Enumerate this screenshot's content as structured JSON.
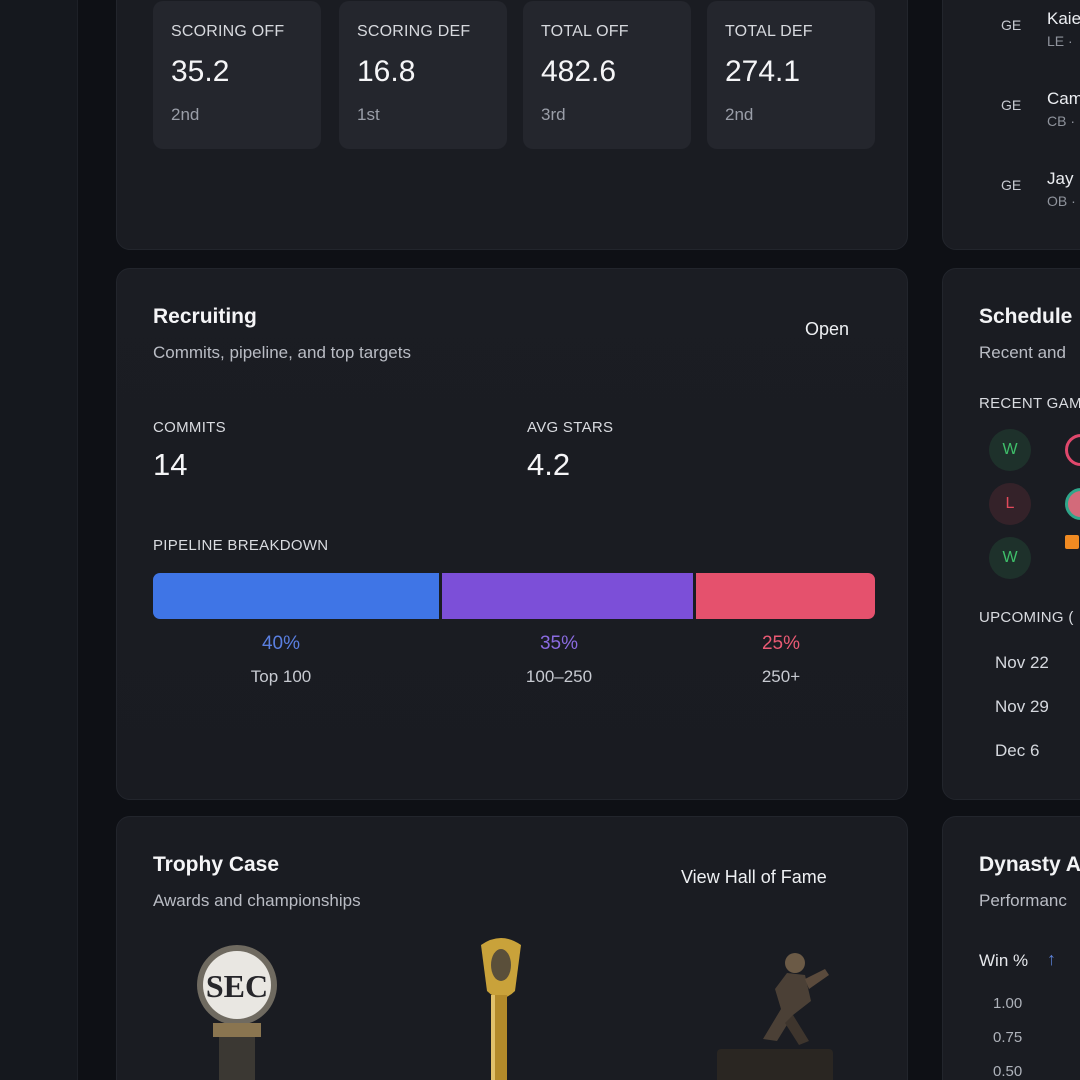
{
  "stats": [
    {
      "label": "SCORING OFF",
      "value": "35.2",
      "rank": "2nd"
    },
    {
      "label": "SCORING DEF",
      "value": "16.8",
      "rank": "1st"
    },
    {
      "label": "TOTAL OFF",
      "value": "482.6",
      "rank": "3rd"
    },
    {
      "label": "TOTAL DEF",
      "value": "274.1",
      "rank": "2nd"
    }
  ],
  "roster": [
    {
      "badge": "GE",
      "name": "Kaie",
      "pos": "LE ·"
    },
    {
      "badge": "GE",
      "name": "Cam",
      "pos": "CB ·"
    },
    {
      "badge": "GE",
      "name": "Jay",
      "pos": "OB ·"
    }
  ],
  "recruiting": {
    "title": "Recruiting",
    "subtitle": "Commits, pipeline, and top targets",
    "open_label": "Open",
    "commits_label": "COMMITS",
    "commits_value": "14",
    "stars_label": "AVG STARS",
    "stars_value": "4.2",
    "pipeline_label": "PIPELINE BREAKDOWN",
    "pipeline": [
      {
        "pct": "40%",
        "category": "Top 100",
        "share": 40,
        "color": "#3f75e6",
        "text_color": "#5a7fe0"
      },
      {
        "pct": "35%",
        "category": "100–250",
        "share": 35,
        "color": "#7c4fd8",
        "text_color": "#8a6be0"
      },
      {
        "pct": "25%",
        "category": "250+",
        "share": 25,
        "color": "#e5516d",
        "text_color": "#ea5a74"
      }
    ]
  },
  "schedule": {
    "title": "Schedule",
    "subtitle": "Recent and",
    "recent_label": "RECENT GAM",
    "results": [
      {
        "result": "W",
        "color": "#3fbf6a"
      },
      {
        "result": "L",
        "color": "#e24a5b"
      },
      {
        "result": "W",
        "color": "#3fbf6a"
      }
    ],
    "upcoming_label": "UPCOMING (",
    "upcoming": [
      "Nov 22",
      "Nov 29",
      "Dec 6"
    ]
  },
  "trophy": {
    "title": "Trophy Case",
    "subtitle": "Awards and championships",
    "link_label": "View Hall of Fame",
    "sec_text": "SEC"
  },
  "analytics": {
    "title": "Dynasty A",
    "subtitle": "Performanc",
    "metric_label": "Win %",
    "ticks": [
      "1.00",
      "0.75",
      "0.50"
    ]
  }
}
